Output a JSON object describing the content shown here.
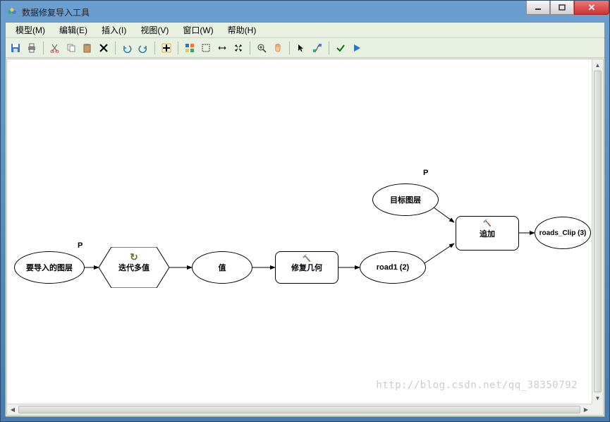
{
  "window": {
    "title": "数据修复导入工具"
  },
  "menu": {
    "model": "模型(M)",
    "edit": "编辑(E)",
    "insert": "插入(I)",
    "view": "视图(V)",
    "window": "窗口(W)",
    "help": "帮助(H)"
  },
  "labels": {
    "p1": "P",
    "p2": "P"
  },
  "nodes": {
    "input_layer": "要导入的图层",
    "iterate": "迭代多值",
    "value": "值",
    "repair_geom": "修复几何",
    "road1": "road1 (2)",
    "target_layer": "目标图层",
    "append": "追加",
    "output": "roads_Clip (3)"
  },
  "watermark": "http://blog.csdn.net/qq_38350792"
}
